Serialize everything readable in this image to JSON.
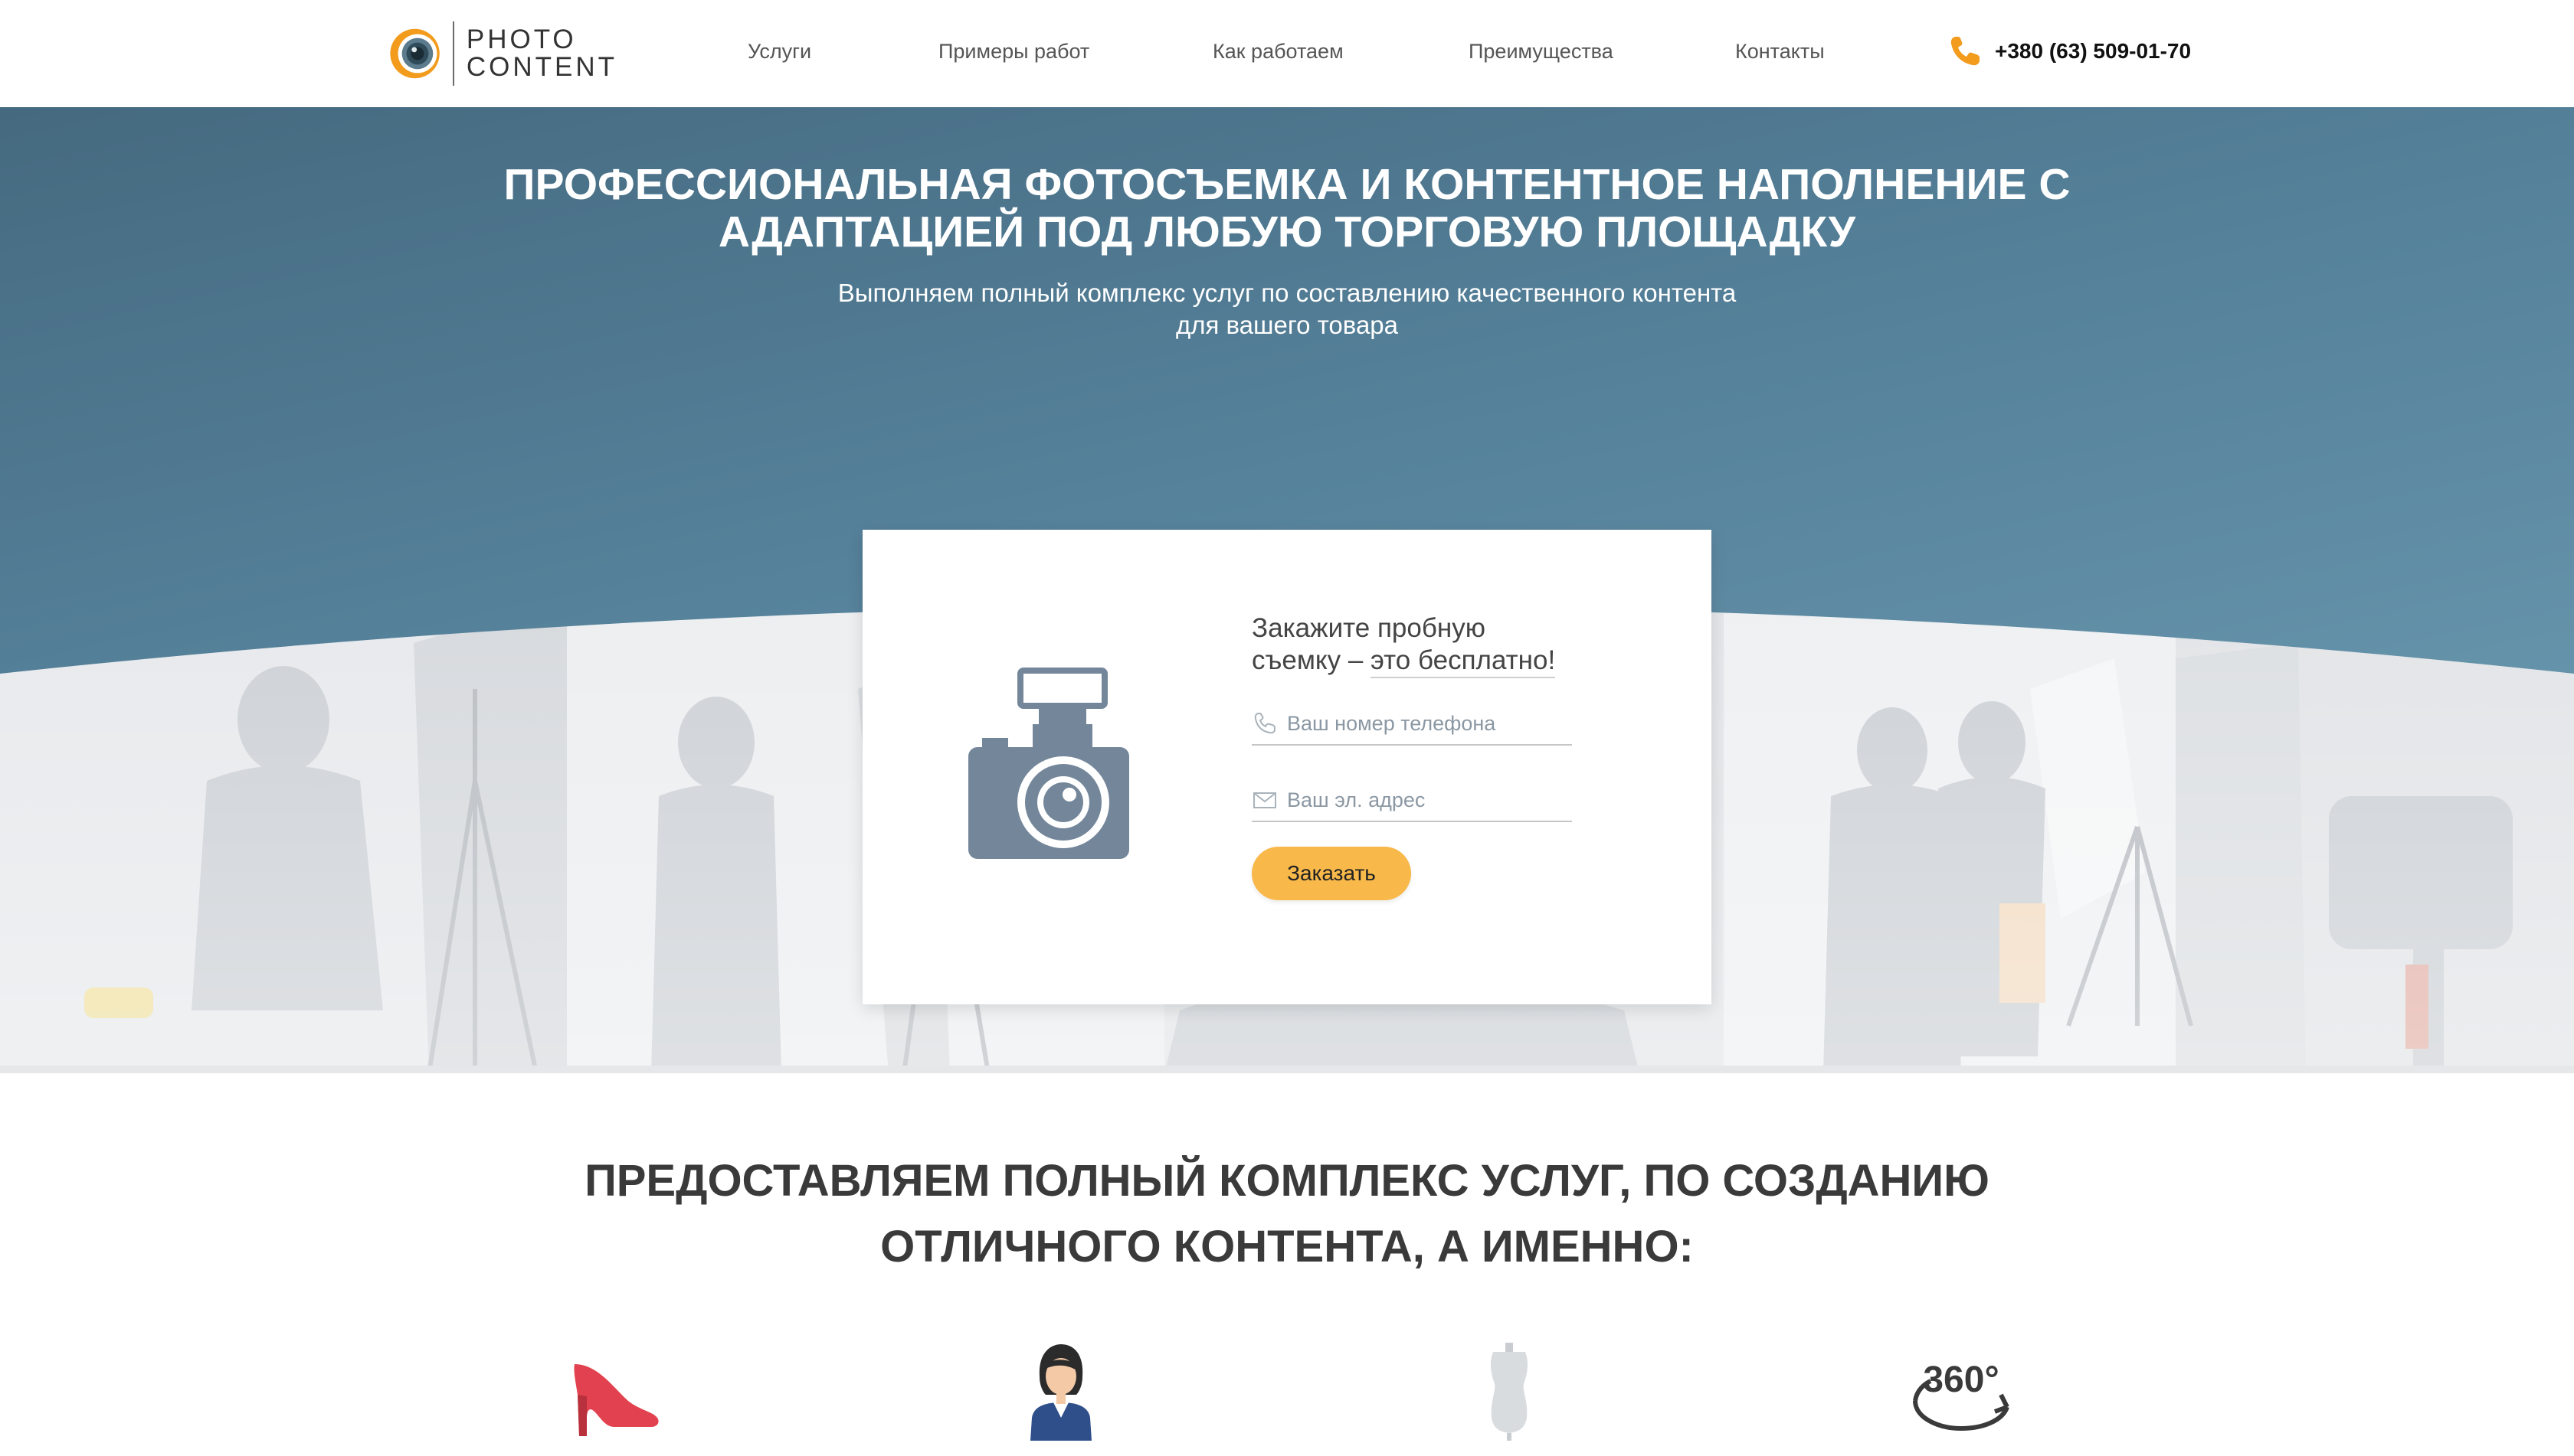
{
  "logo": {
    "line1": "PHOTO",
    "line2": "CONTENT"
  },
  "nav": {
    "items": [
      {
        "label": "Услуги"
      },
      {
        "label": "Примеры работ"
      },
      {
        "label": "Как работаем"
      },
      {
        "label": "Преимущества"
      },
      {
        "label": "Контакты"
      }
    ],
    "phone": "+380 (63) 509-01-70"
  },
  "hero": {
    "title_line1": "ПРОФЕССИОНАЛЬНАЯ ФОТОСЪЕМКА И КОНТЕНТНОЕ НАПОЛНЕНИЕ С",
    "title_line2": "АДАПТАЦИЕЙ ПОД ЛЮБУЮ ТОРГОВУЮ ПЛОЩАДКУ",
    "subtitle_line1": "Выполняем полный комплекс услуг по составлению качественного контента",
    "subtitle_line2": "для вашего товара"
  },
  "form": {
    "heading_line1": "Закажите пробную",
    "heading_line2_prefix": "съемку – ",
    "heading_line2_underlined": "это бесплатно!",
    "phone_placeholder": "Ваш номер телефона",
    "email_placeholder": "Ваш эл. адрес",
    "submit_label": "Заказать"
  },
  "services": {
    "title_line1": "ПРЕДОСТАВЛЯЕМ ПОЛНЫЙ КОМПЛЕКС УСЛУГ, ПО СОЗДАНИЮ",
    "title_line2": "ОТЛИЧНОГО КОНТЕНТА, А ИМЕННО:",
    "icons": [
      {
        "name": "high-heel-shoe-icon"
      },
      {
        "name": "model-woman-icon"
      },
      {
        "name": "mannequin-icon"
      },
      {
        "name": "rotation-360-icon",
        "text": "360°"
      }
    ]
  },
  "colors": {
    "hero_top": "#4c7186",
    "hero_bottom": "#5f8ca2",
    "accent": "#f8b84a",
    "logo_orange": "#f29b1c",
    "camera_icon": "#74869a"
  }
}
